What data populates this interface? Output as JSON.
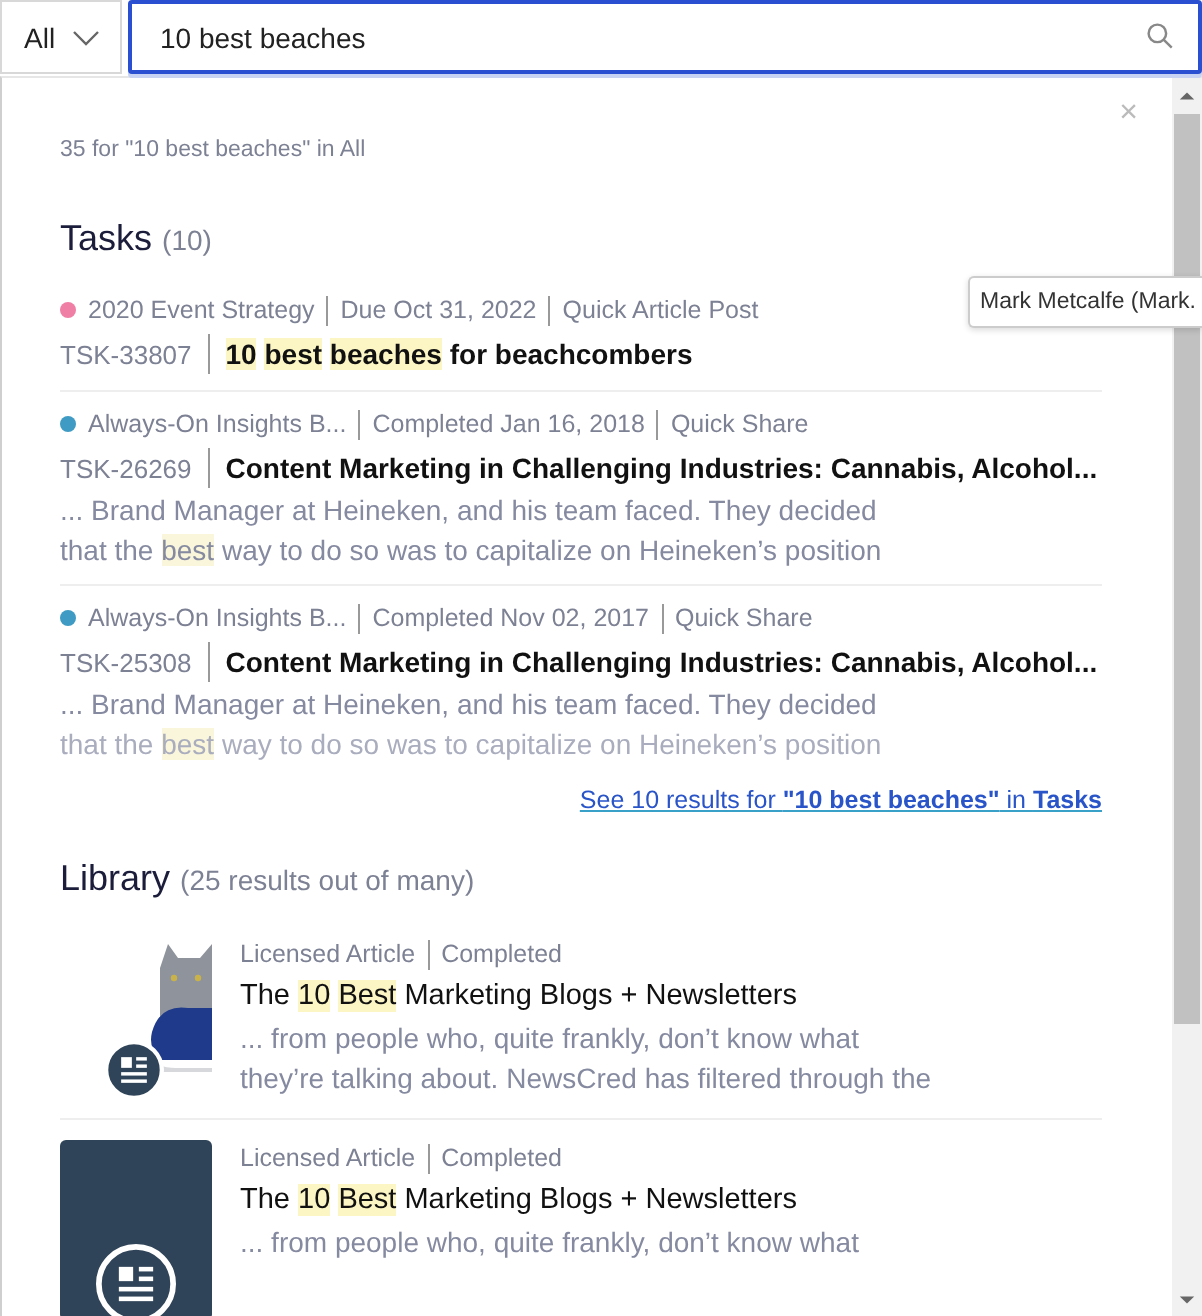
{
  "scope_select": {
    "value": "All"
  },
  "search": {
    "value": "10 best beaches"
  },
  "close": "×",
  "summary": "35 for \"10 best beaches\" in All",
  "tooltip": "Mark Metcalfe (Mark.",
  "tasks": {
    "heading": "Tasks",
    "count": "(10)",
    "items": [
      {
        "color": "#ef7fa4",
        "project": "2020 Event Strategy",
        "status": "Due Oct 31, 2022",
        "type": "Quick Article Post",
        "id": "TSK-33807",
        "title": [
          {
            "text": "10 best beaches",
            "highlight": true
          },
          {
            "text": " for beachcombers",
            "highlight": false
          }
        ]
      },
      {
        "color": "#3f9bc4",
        "project": "Always-On Insights B...",
        "status": "Completed Jan 16, 2018",
        "type": "Quick Share",
        "id": "TSK-26269",
        "title": [
          {
            "text": "Content Marketing in Challenging Industries: Cannabis, Alcohol...",
            "highlight": false
          }
        ],
        "snippet": [
          [
            {
              "text": "... Brand Manager at Heineken, and his team faced. They decided",
              "highlight": false
            }
          ],
          [
            {
              "text": "that the ",
              "highlight": false
            },
            {
              "text": "best",
              "highlight": true
            },
            {
              "text": " way to do so was to capitalize on Heineken’s position",
              "highlight": false
            }
          ]
        ]
      },
      {
        "color": "#3f9bc4",
        "project": "Always-On Insights B...",
        "status": "Completed Nov 02, 2017",
        "type": "Quick Share",
        "id": "TSK-25308",
        "title": [
          {
            "text": "Content Marketing in Challenging Industries: Cannabis, Alcohol...",
            "highlight": false
          }
        ],
        "snippet": [
          [
            {
              "text": "... Brand Manager at Heineken, and his team faced. They decided",
              "highlight": false
            }
          ],
          [
            {
              "text": "that the ",
              "highlight": false
            },
            {
              "text": "best",
              "highlight": true
            },
            {
              "text": " way to do so was to capitalize on Heineken’s position",
              "highlight": false
            }
          ]
        ]
      }
    ],
    "see_all": "See 10 results for **\"10 best beaches\"** in **Tasks**"
  },
  "library": {
    "heading": "Library",
    "count": "(25 results out of many)",
    "items": [
      {
        "kind": "picture",
        "source": "Licensed Article",
        "status": "Completed",
        "title": [
          {
            "text": "The ",
            "highlight": false
          },
          {
            "text": "10 Best",
            "highlight": true
          },
          {
            "text": " Marketing Blogs + Newsletters",
            "highlight": false
          }
        ],
        "snippet": [
          [
            {
              "text": "... from people who, quite frankly, don’t know what",
              "highlight": false
            }
          ],
          [
            {
              "text": "they’re talking about. NewsCred has filtered through the",
              "highlight": false
            }
          ]
        ]
      },
      {
        "kind": "placeholder",
        "source": "Licensed Article",
        "status": "Completed",
        "title": [
          {
            "text": "The ",
            "highlight": false
          },
          {
            "text": "10 Best",
            "highlight": true
          },
          {
            "text": " Marketing Blogs + Newsletters",
            "highlight": false
          }
        ],
        "snippet": [
          [
            {
              "text": "... from people who, quite frankly, don’t know what",
              "highlight": false
            }
          ]
        ]
      }
    ]
  }
}
